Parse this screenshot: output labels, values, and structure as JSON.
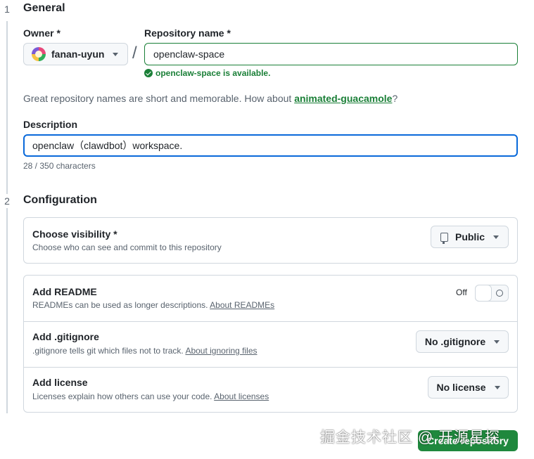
{
  "steps": [
    {
      "number": "1",
      "title": "General"
    },
    {
      "number": "2",
      "title": "Configuration"
    }
  ],
  "owner": {
    "label": "Owner *",
    "value": "fanan-uyun"
  },
  "separator": "/",
  "repo_name": {
    "label": "Repository name *",
    "value": "openclaw-space",
    "status": "openclaw-space is available."
  },
  "name_hint": {
    "text": "Great repository names are short and memorable. How about ",
    "suggestion": "animated-guacamole",
    "suffix": "?"
  },
  "description": {
    "label": "Description",
    "value": "openclaw（clawdbot）workspace.",
    "char_count": "28 / 350 characters"
  },
  "visibility": {
    "title": "Choose visibility *",
    "desc": "Choose who can see and commit to this repository",
    "value": "Public"
  },
  "readme": {
    "title": "Add README",
    "desc": "READMEs can be used as longer descriptions. ",
    "link": "About READMEs",
    "toggle_label": "Off",
    "enabled": false
  },
  "gitignore": {
    "title": "Add .gitignore",
    "desc": ".gitignore tells git which files not to track. ",
    "link": "About ignoring files",
    "value": "No .gitignore"
  },
  "license": {
    "title": "Add license",
    "desc": "Licenses explain how others can use your code. ",
    "link": "About licenses",
    "value": "No license"
  },
  "create_button": "Create repository",
  "watermark": "掘金技术社区 @ 开源星探",
  "colors": {
    "accent_green": "#1f883d",
    "success_text": "#1a7f37",
    "focus_blue": "#0969da",
    "border": "#d0d7de"
  }
}
